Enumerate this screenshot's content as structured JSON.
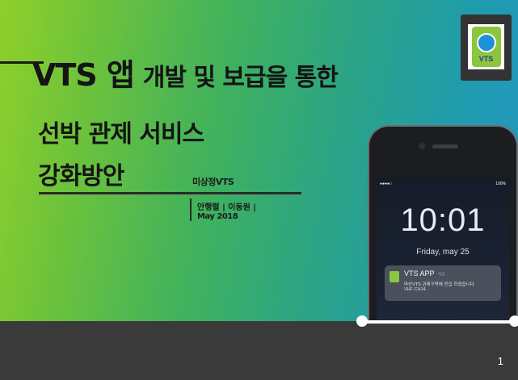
{
  "title": {
    "line1_vts": "VTS 앱",
    "line1_rest": "개발 및 보급을 통한",
    "line2": "선박 관제 서비스",
    "line3": "강화방안"
  },
  "team": "미상정VTS",
  "authors": "안행렬 | 이동원 |",
  "date": "May 2018",
  "logo": {
    "label": "VTS",
    "icon": "compass-logo-icon"
  },
  "phone": {
    "status_left": "●●●●○",
    "status_right": "100%",
    "time": "10:01",
    "date": "Friday, may 25",
    "notification": {
      "app": "VTS APP",
      "time": "지금",
      "body1": "마산VTS 관제구역에 진입 하셨습니다",
      "body2": "VHF CH14."
    }
  },
  "page_number": "1",
  "colors": {
    "gradient_start": "#8fd02a",
    "gradient_end": "#2496c0",
    "footer": "#3a3a3a",
    "title_text": "#141414"
  }
}
